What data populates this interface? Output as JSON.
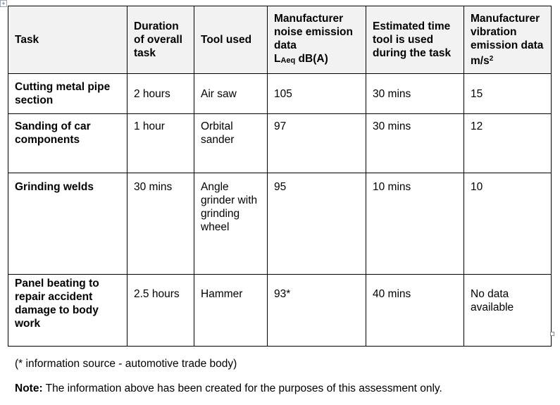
{
  "table": {
    "headers": {
      "task": "Task",
      "duration": "Duration of overall task",
      "tool": "Tool used",
      "noise_line1": "Manufacturer noise emission data",
      "noise_unit_main": "L",
      "noise_unit_sub": "Aeq",
      "noise_unit_rest": " dB(A)",
      "estimated_time": "Estimated time tool is used during the task",
      "vibration_line1": "Manufacturer vibration emission data",
      "vibration_unit": "m/s",
      "vibration_unit_sup": "2"
    },
    "rows": [
      {
        "task": "Cutting metal pipe section",
        "duration": "2 hours",
        "tool": "Air saw",
        "noise": "105",
        "time": "30 mins",
        "vibration": "15"
      },
      {
        "task": "Sanding of car components",
        "duration": "1 hour",
        "tool": "Orbital sander",
        "noise": "97",
        "time": "30 mins",
        "vibration": "12"
      },
      {
        "task": "Grinding welds",
        "duration": "30 mins",
        "tool": "Angle grinder with grinding wheel",
        "noise": "95",
        "time": "10 mins",
        "vibration": "10"
      },
      {
        "task": "Panel beating to repair accident damage to body work",
        "duration": "2.5 hours",
        "tool": "Hammer",
        "noise": "93*",
        "time": "40 mins",
        "vibration": "No data available"
      }
    ]
  },
  "footnote": "(* information source - automotive trade body)",
  "note": {
    "label": "Note:",
    "text": " The information above has been created for the purposes of this assessment only."
  },
  "icons": {
    "move_handle": "table-move-handle-icon",
    "resize_handle": "table-resize-handle-icon"
  }
}
